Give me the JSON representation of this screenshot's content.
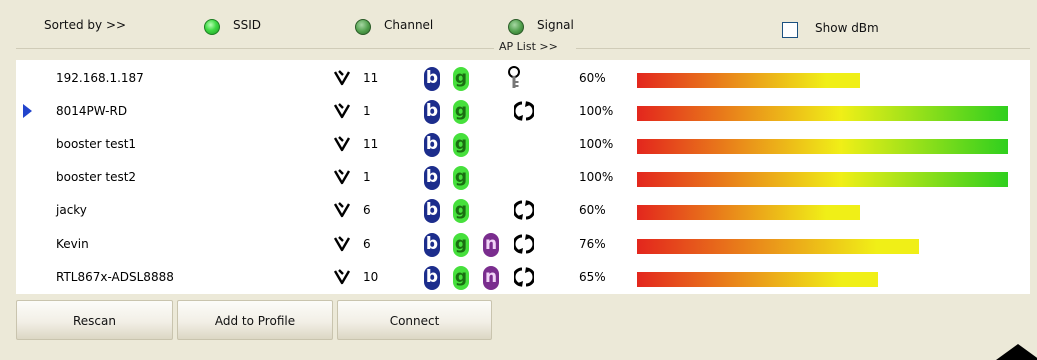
{
  "sort": {
    "label": "Sorted by >>",
    "options": [
      {
        "label": "SSID",
        "selected": true
      },
      {
        "label": "Channel",
        "selected": false
      },
      {
        "label": "Signal",
        "selected": false
      }
    ],
    "show_dbm": {
      "label": "Show dBm",
      "checked": false
    }
  },
  "ap_list": {
    "title": "AP List >>",
    "rows": [
      {
        "ssid": "192.168.1.187",
        "channel": "11",
        "b": true,
        "g": true,
        "n": false,
        "security": "key",
        "signal_pct": "60%",
        "signal": 0.6
      },
      {
        "ssid": "8014PW-RD",
        "channel": "1",
        "b": true,
        "g": true,
        "n": false,
        "security": "wps",
        "signal_pct": "100%",
        "signal": 1.0,
        "current": true
      },
      {
        "ssid": "booster test1",
        "channel": "11",
        "b": true,
        "g": true,
        "n": false,
        "security": "",
        "signal_pct": "100%",
        "signal": 1.0
      },
      {
        "ssid": "booster test2",
        "channel": "1",
        "b": true,
        "g": true,
        "n": false,
        "security": "",
        "signal_pct": "100%",
        "signal": 1.0
      },
      {
        "ssid": "jacky",
        "channel": "6",
        "b": true,
        "g": true,
        "n": false,
        "security": "wps",
        "signal_pct": "60%",
        "signal": 0.6
      },
      {
        "ssid": "Kevin",
        "channel": "6",
        "b": true,
        "g": true,
        "n": true,
        "security": "wps",
        "signal_pct": "76%",
        "signal": 0.76
      },
      {
        "ssid": "RTL867x-ADSL8888",
        "channel": "10",
        "b": true,
        "g": true,
        "n": true,
        "security": "wps",
        "signal_pct": "65%",
        "signal": 0.65
      }
    ]
  },
  "buttons": {
    "rescan": "Rescan",
    "add_to_profile": "Add to Profile",
    "connect": "Connect"
  },
  "badges": {
    "b": "b",
    "g": "g",
    "n": "n"
  },
  "colors": {
    "bar_start": "#e3261d",
    "bar_mid": "#f0ef17",
    "bar_end": "#2fcf1e",
    "selection_arrow": "#2244cc"
  }
}
